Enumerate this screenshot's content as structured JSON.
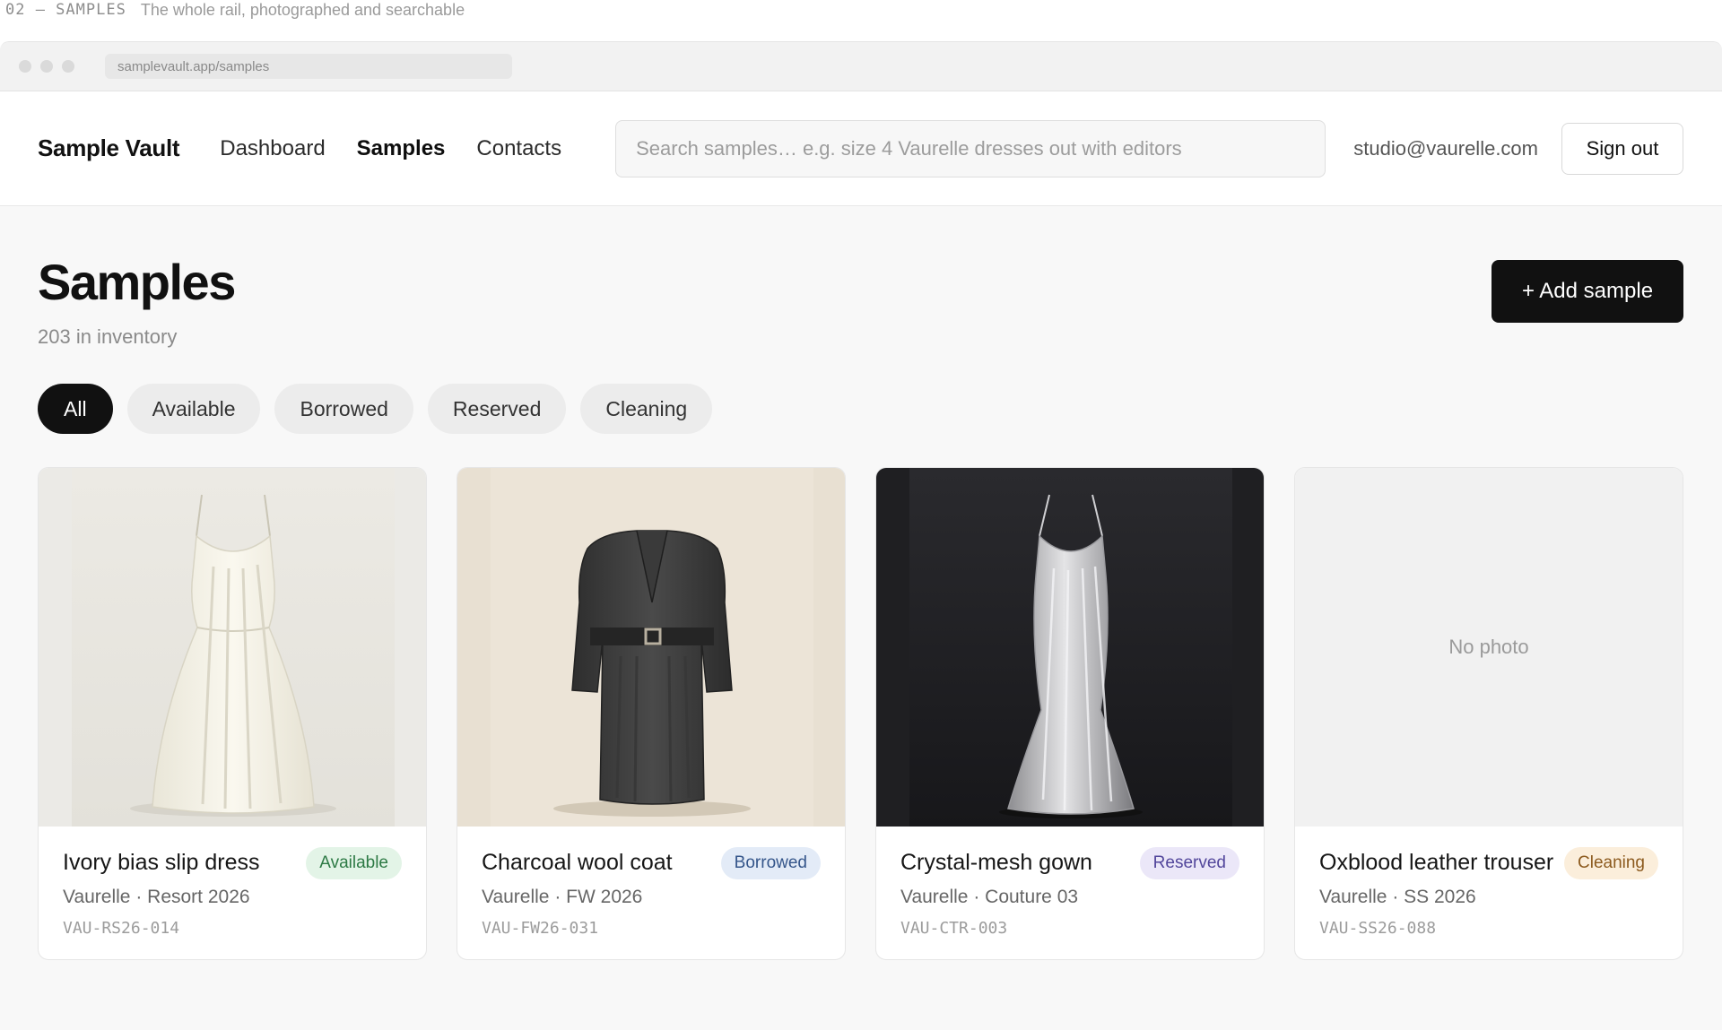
{
  "caption": {
    "code": "02 — SAMPLES",
    "description": "The whole rail, photographed and searchable"
  },
  "browser": {
    "url": "samplevault.app/samples"
  },
  "nav": {
    "brand": "Sample Vault",
    "links": [
      {
        "label": "Dashboard",
        "active": false
      },
      {
        "label": "Samples",
        "active": true
      },
      {
        "label": "Contacts",
        "active": false
      }
    ],
    "search_placeholder": "Search samples… e.g. size 4 Vaurelle dresses out with editors",
    "user_email": "studio@vaurelle.com",
    "signout_label": "Sign out"
  },
  "page": {
    "title": "Samples",
    "count_text": "203 in inventory",
    "add_button_label": "+ Add sample"
  },
  "filters": [
    {
      "label": "All",
      "active": true
    },
    {
      "label": "Available",
      "active": false
    },
    {
      "label": "Borrowed",
      "active": false
    },
    {
      "label": "Reserved",
      "active": false
    },
    {
      "label": "Cleaning",
      "active": false
    }
  ],
  "samples": [
    {
      "name": "Ivory bias slip dress",
      "status": "Available",
      "brand_season": "Vaurelle · Resort 2026",
      "sku": "VAU-RS26-014",
      "photo": "ivory-slip-dress-photo"
    },
    {
      "name": "Charcoal wool coat",
      "status": "Borrowed",
      "brand_season": "Vaurelle · FW 2026",
      "sku": "VAU-FW26-031",
      "photo": "charcoal-coat-photo"
    },
    {
      "name": "Crystal-mesh gown",
      "status": "Reserved",
      "brand_season": "Vaurelle · Couture 03",
      "sku": "VAU-CTR-003",
      "photo": "crystal-gown-photo"
    },
    {
      "name": "Oxblood leather trouser",
      "status": "Cleaning",
      "brand_season": "Vaurelle · SS 2026",
      "sku": "VAU-SS26-088",
      "photo_placeholder": "No photo"
    }
  ],
  "colors": {
    "accent": "#111111",
    "available": "#2d7a45",
    "borrowed": "#34558a",
    "reserved": "#52469b",
    "cleaning": "#8c5a1e"
  }
}
